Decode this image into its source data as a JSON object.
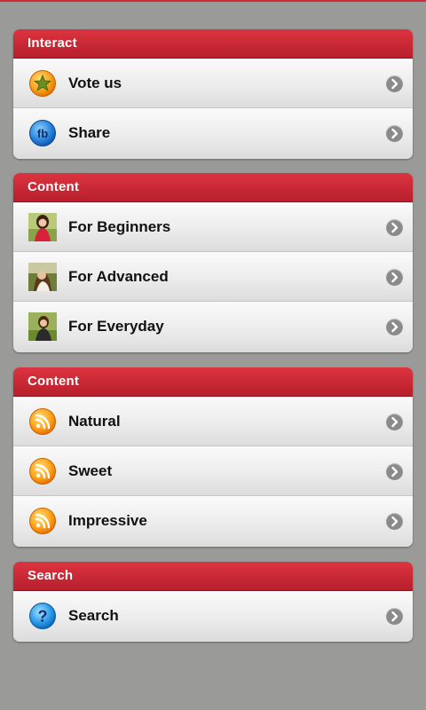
{
  "colors": {
    "header_red": "#cc2a35",
    "background": "#9a9a98"
  },
  "sections": [
    {
      "title": "Interact",
      "items": [
        {
          "label": "Vote us",
          "icon": "star-medal-icon"
        },
        {
          "label": "Share",
          "icon": "facebook-icon"
        }
      ]
    },
    {
      "title": "Content",
      "items": [
        {
          "label": "For Beginners",
          "icon": "beginner-photo-thumbnail"
        },
        {
          "label": "For Advanced",
          "icon": "advanced-photo-thumbnail"
        },
        {
          "label": "For Everyday",
          "icon": "everyday-photo-thumbnail"
        }
      ]
    },
    {
      "title": "Content",
      "items": [
        {
          "label": "Natural",
          "icon": "rss-feed-icon"
        },
        {
          "label": "Sweet",
          "icon": "rss-feed-icon"
        },
        {
          "label": "Impressive",
          "icon": "rss-feed-icon"
        }
      ]
    },
    {
      "title": "Search",
      "items": [
        {
          "label": "Search",
          "icon": "help-question-icon"
        }
      ]
    }
  ]
}
